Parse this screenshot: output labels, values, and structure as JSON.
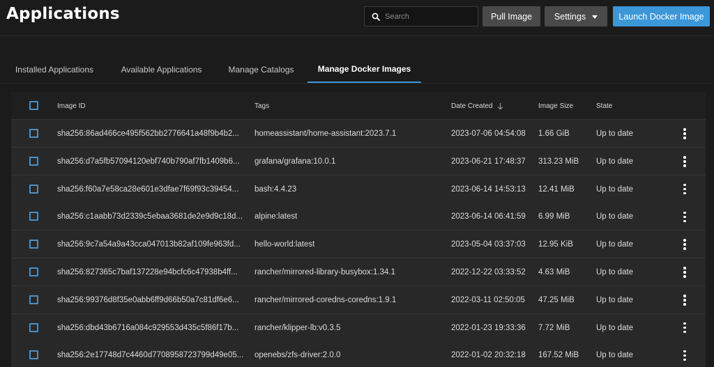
{
  "header": {
    "title": "Applications",
    "search_placeholder": "Search",
    "pull_image_label": "Pull Image",
    "settings_label": "Settings",
    "launch_label": "Launch Docker Image"
  },
  "tabs": [
    {
      "label": "Installed Applications"
    },
    {
      "label": "Available Applications"
    },
    {
      "label": "Manage Catalogs"
    },
    {
      "label": "Manage Docker Images",
      "active": true
    }
  ],
  "table": {
    "columns": {
      "image_id": "Image ID",
      "tags": "Tags",
      "date_created": "Date Created",
      "image_size": "Image Size",
      "state": "State"
    },
    "rows": [
      {
        "id": "sha256:86ad466ce495f562bb2776641a48f9b4b2...",
        "tags": "homeassistant/home-assistant:2023.7.1",
        "date": "2023-07-06 04:54:08",
        "size": "1.66 GiB",
        "state": "Up to date"
      },
      {
        "id": "sha256:d7a5fb57094120ebf740b790af7fb1409b6...",
        "tags": "grafana/grafana:10.0.1",
        "date": "2023-06-21 17:48:37",
        "size": "313.23 MiB",
        "state": "Up to date"
      },
      {
        "id": "sha256:f60a7e58ca28e601e3dfae7f69f93c39454...",
        "tags": "bash:4.4.23",
        "date": "2023-06-14 14:53:13",
        "size": "12.41 MiB",
        "state": "Up to date"
      },
      {
        "id": "sha256:c1aabb73d2339c5ebaa3681de2e9d9c18d...",
        "tags": "alpine:latest",
        "date": "2023-06-14 06:41:59",
        "size": "6.99 MiB",
        "state": "Up to date"
      },
      {
        "id": "sha256:9c7a54a9a43cca047013b82af109fe963fd...",
        "tags": "hello-world:latest",
        "date": "2023-05-04 03:37:03",
        "size": "12.95 KiB",
        "state": "Up to date"
      },
      {
        "id": "sha256:827365c7baf137228e94bcfc6c47938b4ff...",
        "tags": "rancher/mirrored-library-busybox:1.34.1",
        "date": "2022-12-22 03:33:52",
        "size": "4.63 MiB",
        "state": "Up to date"
      },
      {
        "id": "sha256:99376d8f35e0abb6ff9d66b50a7c81df6e6...",
        "tags": "rancher/mirrored-coredns-coredns:1.9.1",
        "date": "2022-03-11 02:50:05",
        "size": "47.25 MiB",
        "state": "Up to date"
      },
      {
        "id": "sha256:dbd43b6716a084c929553d435c5f86f17b...",
        "tags": "rancher/klipper-lb:v0.3.5",
        "date": "2022-01-23 19:33:36",
        "size": "7.72 MiB",
        "state": "Up to date"
      },
      {
        "id": "sha256:2e17748d7c4460d7708958723799d49e05...",
        "tags": "openebs/zfs-driver:2.0.0",
        "date": "2022-01-02 20:32:18",
        "size": "167.52 MiB",
        "state": "Up to date"
      }
    ]
  },
  "icons": {
    "search": "search-icon",
    "settings_caret": "caret-down-icon",
    "sort": "arrow-down-icon",
    "row_menu": "more-vertical-icon"
  },
  "colors": {
    "accent": "#3c97d8",
    "background": "#1b1b1b",
    "button_gray": "#4a4a4a"
  }
}
